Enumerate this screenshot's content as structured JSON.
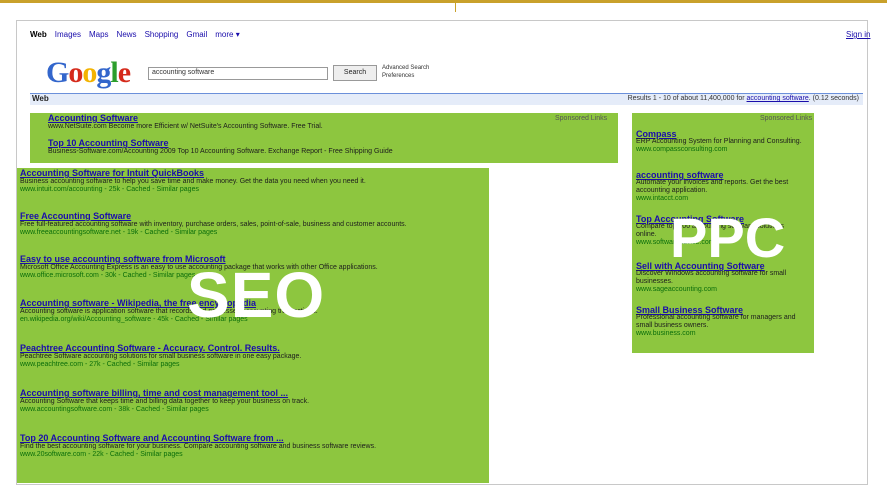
{
  "nav": {
    "items": [
      "Web",
      "Images",
      "Maps",
      "News",
      "Shopping",
      "Gmail",
      "more ▾"
    ],
    "sign_in": "Sign in"
  },
  "search": {
    "logo": [
      "G",
      "o",
      "o",
      "g",
      "l",
      "e"
    ],
    "query": "accounting software",
    "button": "Search",
    "advanced": "Advanced Search",
    "preferences": "Preferences"
  },
  "webbar": {
    "label": "Web",
    "stats_prefix": "Results 1 - 10 of about 11,400,000 for ",
    "stats_query": "accounting software",
    "stats_suffix": ". (0.12 seconds)"
  },
  "sponsored": {
    "top": "Sponsored Links",
    "right": "Sponsored Links"
  },
  "top_ads": [
    {
      "title": "Accounting Software",
      "desc": "www.NetSuite.com    Become more Efficient w/ NetSuite's Accounting Software. Free Trial."
    },
    {
      "title": "Top 10 Accounting Software",
      "desc": "Business-Software.com/Accounting    2009 Top 10 Accounting Software. Exchange Report - Free Shipping Guide"
    }
  ],
  "results": [
    {
      "title": "Accounting Software for Intuit QuickBooks",
      "desc": "Business accounting software to help you save time and make money. Get the data you need when you need it.",
      "url": "www.intuit.com/accounting - 25k - Cached - Similar pages"
    },
    {
      "title": "Free Accounting Software",
      "desc": "Free full-featured accounting software with inventory, purchase orders, sales, point-of-sale, business and customer accounts.",
      "url": "www.freeaccountingsoftware.net - 19k - Cached - Similar pages"
    },
    {
      "title": "Easy to use accounting software from Microsoft",
      "desc": "Microsoft Office Accounting Express is an easy to use accounting package that works with other Office applications.",
      "url": "www.office.microsoft.com - 30k - Cached - Similar pages"
    },
    {
      "title": "Accounting software - Wikipedia, the free encyclopedia",
      "desc": "Accounting software is application software that records and processes accounting transactions.",
      "url": "en.wikipedia.org/wiki/Accounting_software - 45k - Cached - Similar pages"
    },
    {
      "title": "Peachtree Accounting Software - Accuracy. Control. Results.",
      "desc": "Peachtree Software accounting solutions for small business software in one easy package.",
      "url": "www.peachtree.com - 27k - Cached - Similar pages"
    },
    {
      "title": "Accounting software billing, time and cost management tool ...",
      "desc": "Accounting Software that keeps time and billing data together to keep your business on track.",
      "url": "www.accountingsoftware.com - 38k - Cached - Similar pages"
    },
    {
      "title": "Top 20 Accounting Software and Accounting Software from ...",
      "desc": "Find the best accounting software for your business. Compare accounting software and business software reviews.",
      "url": "www.20software.com - 22k - Cached - Similar pages"
    }
  ],
  "right_ads": [
    {
      "title": "Compass",
      "desc": "ERP Accounting System for Planning and Consulting.",
      "url": "www.compassconsulting.com"
    },
    {
      "title": "accounting software",
      "desc": "Automate your invoices and reports. Get the best accounting application.",
      "url": "www.intacct.com"
    },
    {
      "title": "Top Accounting Software",
      "desc": "Compare top 100 accounting software solutions online.",
      "url": "www.softwareadvice.com"
    },
    {
      "title": "Sell with Accounting Software",
      "desc": "Discover Windows accounting software for small businesses.",
      "url": "www.sageaccounting.com"
    },
    {
      "title": "Small Business Software",
      "desc": "Professional accounting software for managers and small business owners.",
      "url": "www.business.com"
    }
  ],
  "overlay": {
    "seo": "SEO",
    "ppc": "PPC"
  },
  "colors": {
    "highlight": "#8dc63f",
    "frame": "#c9a12b",
    "link": "#1a0dab"
  }
}
